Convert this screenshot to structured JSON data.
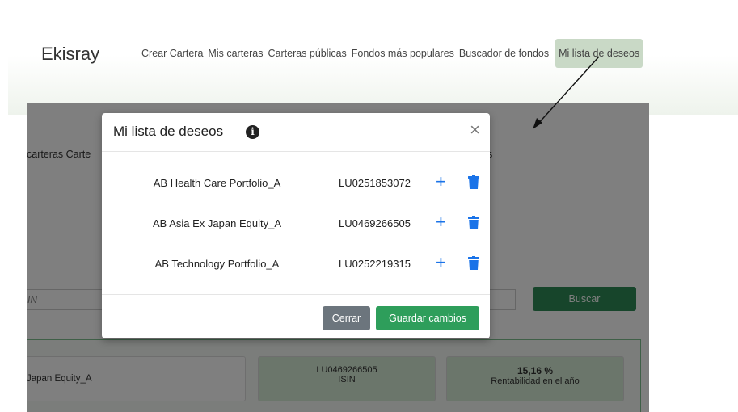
{
  "navbar": {
    "brand": "Ekisray",
    "items": [
      {
        "label": "Crear Cartera"
      },
      {
        "label": "Mis carteras"
      },
      {
        "label": "Carteras públicas"
      },
      {
        "label": "Fondos más populares"
      },
      {
        "label": "Buscador de fondos"
      },
      {
        "label": "Mi lista de deseos",
        "active": true
      }
    ]
  },
  "background": {
    "subnav_left": "carteras   Carte",
    "subnav_right": "s",
    "search_placeholder": "IN",
    "search_button": "Buscar",
    "fund_name": "Japan Equity_A",
    "isin_value": "LU0469266505",
    "isin_label": "ISIN",
    "return_value": "15,16 %",
    "return_label": "Rentabilidad en el año"
  },
  "modal": {
    "title": "Mi lista de deseos",
    "info_glyph": "i",
    "close_glyph": "×",
    "rows": [
      {
        "name": "AB Health Care Portfolio_A",
        "isin": "LU0251853072"
      },
      {
        "name": "AB Asia Ex Japan Equity_A",
        "isin": "LU0469266505"
      },
      {
        "name": "AB Technology Portfolio_A",
        "isin": "LU0252219315"
      }
    ],
    "plus_glyph": "+",
    "close_button": "Cerrar",
    "save_button": "Guardar cambios"
  },
  "colors": {
    "accent_green": "#2e9e5b",
    "icon_blue": "#1a73e8",
    "active_nav_bg": "#c9d9c6",
    "close_btn_grey": "#6c757d"
  },
  "icons": {
    "info": "info-icon",
    "close": "close-icon",
    "add": "plus-icon",
    "delete": "trash-icon"
  }
}
